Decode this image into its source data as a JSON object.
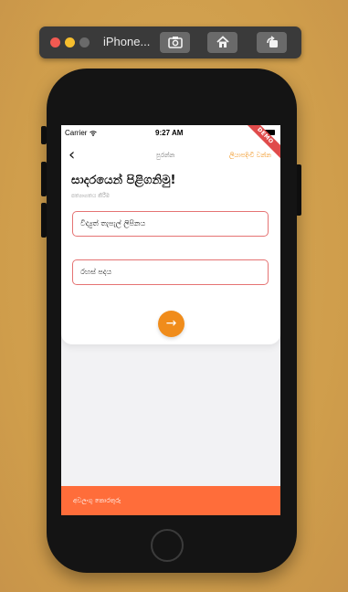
{
  "simulator": {
    "title": "iPhone...",
    "buttons": [
      {
        "icon": "camera-icon"
      },
      {
        "icon": "home-icon"
      },
      {
        "icon": "rotate-icon"
      }
    ]
  },
  "status_bar": {
    "carrier": "Carrier",
    "time": "9:27 AM"
  },
  "nav": {
    "back_label": "‹",
    "center_label": "පුරන්න",
    "right_label": "ලියාපදිංචි වන්න"
  },
  "ribbon": {
    "text": "DEMO"
  },
  "login": {
    "heading": "සාදරයෙන් පිළිගනිමු!",
    "subheading": "පත්‍යාගතය කිරීම",
    "email_placeholder": "විද්‍යුත් තැපැල් ලිපිනය",
    "password_placeholder": "රහස් පදය",
    "next_symbol": "→"
  },
  "footer": {
    "label": "අවලංගු කොරතුරු"
  },
  "colors": {
    "accent": "#f08c1b",
    "footer": "#ff6d3a",
    "field_border": "#e57373",
    "ribbon": "#e04b4b",
    "desktop_bg": "#d3a24f"
  }
}
